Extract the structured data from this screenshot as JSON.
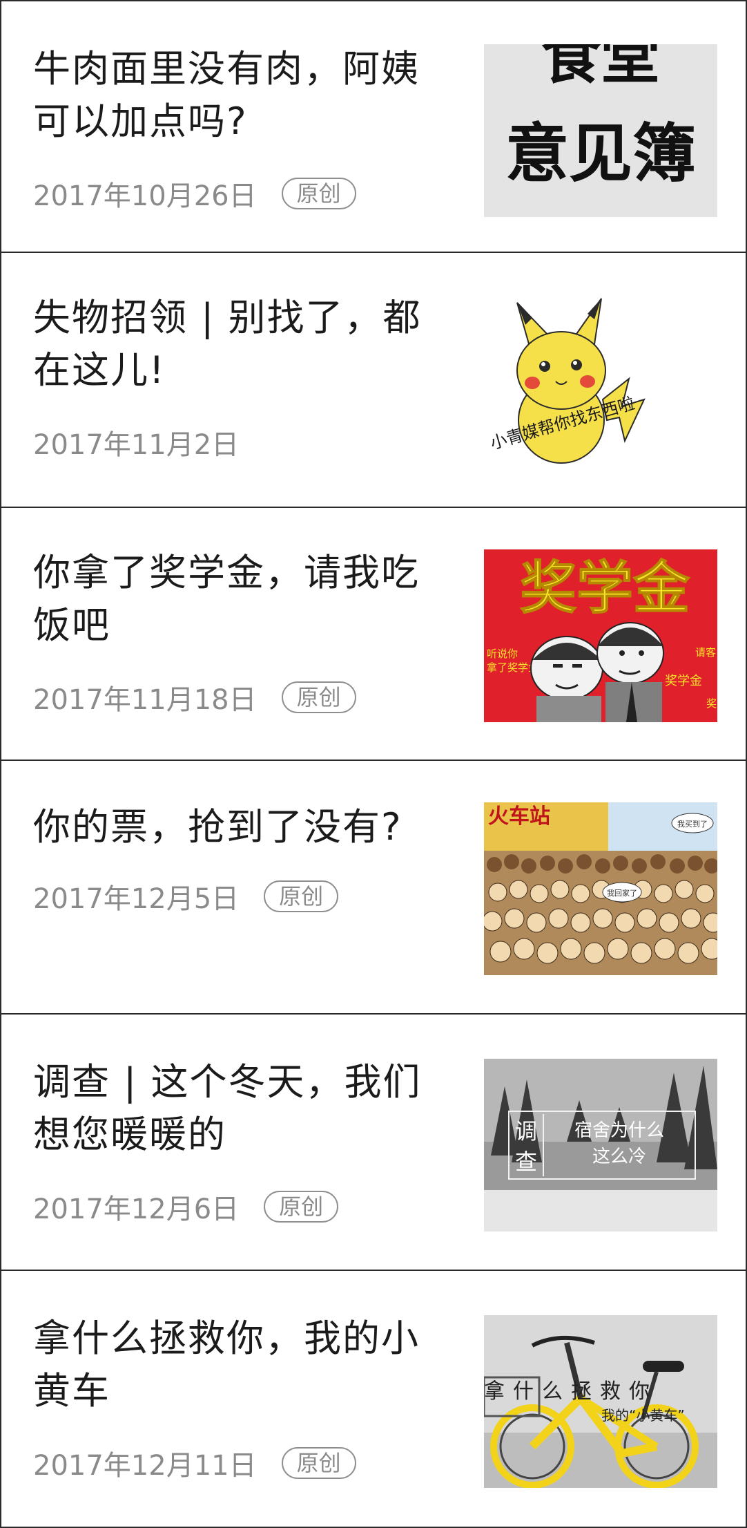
{
  "articles": [
    {
      "title": "牛肉面里没有肉，阿姨可以加点吗?",
      "date": "2017年10月26日",
      "badge": "原创",
      "thumb_text": [
        "食堂",
        "意见簿"
      ]
    },
    {
      "title": "失物招领 | 别找了，都在这儿!",
      "date": "2017年11月2日",
      "badge": "",
      "thumb_text": [
        "小青媒帮你找东西啦"
      ]
    },
    {
      "title": "你拿了奖学金，请我吃饭吧",
      "date": "2017年11月18日",
      "badge": "原创",
      "thumb_text": [
        "奖学金",
        "听说你",
        "拿了奖学金",
        "请客",
        "奖学金",
        "奖"
      ]
    },
    {
      "title": "你的票，抢到了没有?",
      "date": "2017年12月5日",
      "badge": "原创",
      "thumb_text": [
        "火车站",
        "我买到了",
        "我回家了"
      ]
    },
    {
      "title": "调查 | 这个冬天，我们想您暖暖的",
      "date": "2017年12月6日",
      "badge": "原创",
      "thumb_text": [
        "调",
        "查",
        "宿舍为什么",
        "这么冷"
      ]
    },
    {
      "title": "拿什么拯救你，我的小黄车",
      "date": "2017年12月11日",
      "badge": "原创",
      "thumb_text": [
        "拿什么拯救你",
        "我的“小黄车”"
      ]
    }
  ],
  "colors": {
    "border": "#2b2b2b",
    "title": "#1b1b1b",
    "meta": "#8a8a8a",
    "scholarship_red": "#e0202a",
    "scholarship_yellow": "#f7e32a",
    "bike_yellow": "#f2d31a"
  }
}
